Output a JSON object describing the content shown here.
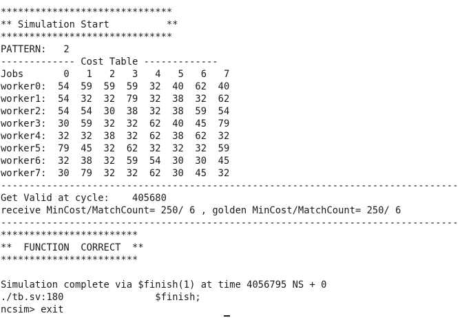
{
  "terminal": {
    "lines": [
      "******************************",
      "** Simulation Start          **",
      "******************************",
      "PATTERN:   2",
      "------------- Cost Table -------------",
      "Jobs       0   1   2   3   4   5   6   7",
      "worker0:  54  59  59  59  32  40  62  40",
      "worker1:  54  32  32  79  32  38  32  62",
      "worker2:  54  54  30  38  32  38  59  54",
      "worker3:  30  59  32  32  62  40  45  79",
      "worker4:  32  32  38  32  62  38  62  32",
      "worker5:  79  45  32  62  32  32  32  59",
      "worker6:  32  38  32  59  54  30  30  45",
      "worker7:  30  79  32  32  62  30  45  32",
      "--------------------------------------------------------------------------------",
      "Get Valid at cycle:    405680",
      "receive MinCost/MatchCount= 250/ 6 , golden MinCost/MatchCount= 250/ 6",
      "--------------------------------------------------------------------------------",
      "************************",
      "**  FUNCTION  CORRECT  **",
      "************************",
      "",
      "Simulation complete via $finish(1) at time 4056795 NS + 0",
      "./tb.sv:180                $finish;",
      "ncsim> exit"
    ]
  }
}
